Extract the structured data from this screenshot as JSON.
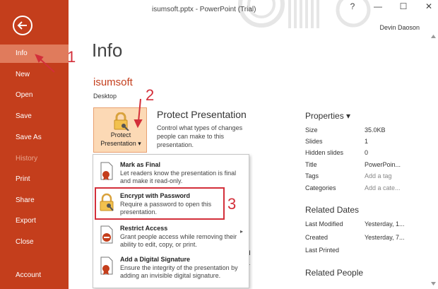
{
  "window": {
    "title": "isumsoft.pptx - PowerPoint (Trial)",
    "user": "Devin Daoson",
    "controls": [
      "?",
      "—",
      "☐",
      "✕"
    ]
  },
  "sidebar": {
    "back_icon": "back-arrow-icon",
    "items": [
      {
        "label": "Info"
      },
      {
        "label": "New"
      },
      {
        "label": "Open"
      },
      {
        "label": "Save"
      },
      {
        "label": "Save As"
      },
      {
        "label": "History"
      },
      {
        "label": "Print"
      },
      {
        "label": "Share"
      },
      {
        "label": "Export"
      },
      {
        "label": "Close"
      },
      {
        "label": "Account"
      }
    ]
  },
  "main": {
    "title": "Info",
    "doc_name": "isumsoft",
    "doc_location": "Desktop",
    "protect_button": {
      "line1": "Protect",
      "line2": "Presentation ▾"
    },
    "protect_section": {
      "title": "Protect Presentation",
      "description": "Control what types of changes people can make to this presentation."
    },
    "partial_texts": [
      "ware",
      "n",
      "er"
    ]
  },
  "dropdown": {
    "items": [
      {
        "title": "Mark as Final",
        "desc": "Let readers know the presentation is final and make it read-only.",
        "icon": "mark-final-icon"
      },
      {
        "title": "Encrypt with Password",
        "desc": "Require a password to open this presentation.",
        "icon": "lock-key-icon"
      },
      {
        "title": "Restrict Access",
        "desc": "Grant people access while removing their ability to edit, copy, or print.",
        "icon": "restrict-icon",
        "arrow": "▸"
      },
      {
        "title": "Add a Digital Signature",
        "desc": "Ensure the integrity of the presentation by adding an invisible digital signature.",
        "icon": "signature-icon"
      }
    ]
  },
  "properties": {
    "title": "Properties ▾",
    "rows": [
      {
        "label": "Size",
        "value": "35.0KB"
      },
      {
        "label": "Slides",
        "value": "1"
      },
      {
        "label": "Hidden slides",
        "value": "0"
      },
      {
        "label": "Title",
        "value": "PowerPoin..."
      },
      {
        "label": "Tags",
        "value": "Add a tag"
      },
      {
        "label": "Categories",
        "value": "Add a cate..."
      }
    ]
  },
  "related_dates": {
    "title": "Related Dates",
    "rows": [
      {
        "label": "Last Modified",
        "value": "Yesterday, 1..."
      },
      {
        "label": "Created",
        "value": "Yesterday, 7..."
      },
      {
        "label": "Last Printed",
        "value": ""
      }
    ]
  },
  "related_people": {
    "title": "Related People"
  },
  "annotations": {
    "step1": "1",
    "step2": "2",
    "step3": "3",
    "color": "#d32f3a"
  },
  "colors": {
    "accent": "#c43e1c",
    "active_nav": "#e07b5c",
    "button_bg": "#fcd9b5"
  }
}
